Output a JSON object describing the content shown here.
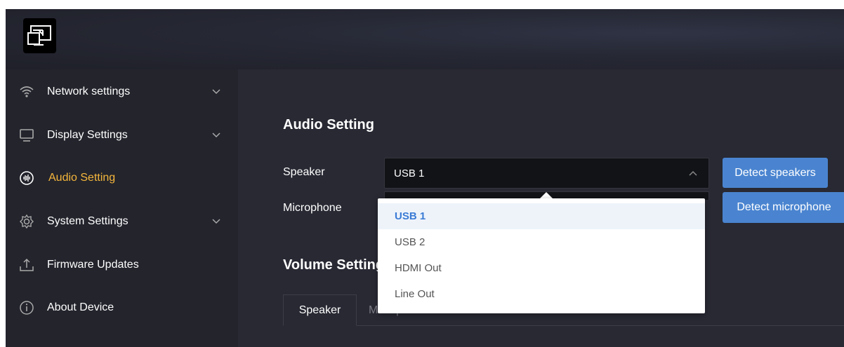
{
  "sidebar": {
    "items": [
      {
        "label": "Network settings",
        "icon": "wifi-icon",
        "expandable": true
      },
      {
        "label": "Display Settings",
        "icon": "monitor-icon",
        "expandable": true
      },
      {
        "label": "Audio Setting",
        "icon": "audio-wave-icon",
        "expandable": false,
        "active": true
      },
      {
        "label": "System Settings",
        "icon": "gear-icon",
        "expandable": true
      },
      {
        "label": "Firmware Updates",
        "icon": "upload-icon",
        "expandable": false
      },
      {
        "label": "About Device",
        "icon": "info-icon",
        "expandable": false
      }
    ]
  },
  "main": {
    "audio_title": "Audio Setting",
    "speaker_label": "Speaker",
    "microphone_label": "Microphone",
    "speaker_value": "USB 1",
    "detect_speakers_label": "Detect speakers",
    "detect_microphone_label": "Detect microphone",
    "volume_title": "Volume Settings",
    "tabs": [
      {
        "label": "Speaker",
        "active": true
      },
      {
        "label": "Microphone",
        "active": false
      }
    ]
  },
  "dropdown": {
    "options": [
      {
        "label": "USB 1",
        "selected": true
      },
      {
        "label": "USB 2",
        "selected": false
      },
      {
        "label": "HDMI Out",
        "selected": false
      },
      {
        "label": "Line Out",
        "selected": false
      }
    ]
  },
  "colors": {
    "accent_active": "#f5b63c",
    "button_blue": "#4a84d0",
    "selected_option": "#3a7bd5",
    "background_dark": "#22232c"
  }
}
